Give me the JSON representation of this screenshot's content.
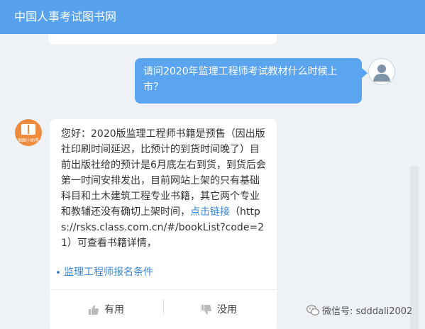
{
  "header": {
    "title": "中国人事考试图书网"
  },
  "user_message": {
    "text": "请问2020年监理工程师考试教材什么时候上市？"
  },
  "bot_avatar": {
    "caption": "图图小助手"
  },
  "bot_reply": {
    "text_before": "您好：2020版监理工程师书籍是预售（因出版社印刷时间延迟，比预计的到货时间晚了）目前出版社给的预计是6月底左右到货，到货后会第一时间安排发出，目前网站上架的只有基础科目和土木建筑工程专业书籍，其它两个专业和教辅还没有确切上架时间，",
    "link_text": "点击链接",
    "text_after": "（https://rsks.class.com.cn/#/bookList?code=21）可查看书籍详情，"
  },
  "related_link": "监理工程师报名条件",
  "feedback": {
    "useful_label": "有用",
    "useless_label": "没用"
  },
  "watermark": {
    "text": "微信号: sdddali2002"
  },
  "colors": {
    "header": "#57a1ee",
    "user_bubble": "#5ba5f0",
    "link": "#3b86d6",
    "bot_avatar": "#ee8a3c"
  },
  "icons": {
    "user_avatar": "user-icon",
    "bot_avatar": "book-icon",
    "useful": "thumbs-up-icon",
    "useless": "thumbs-down-icon",
    "watermark": "wechat-icon"
  }
}
